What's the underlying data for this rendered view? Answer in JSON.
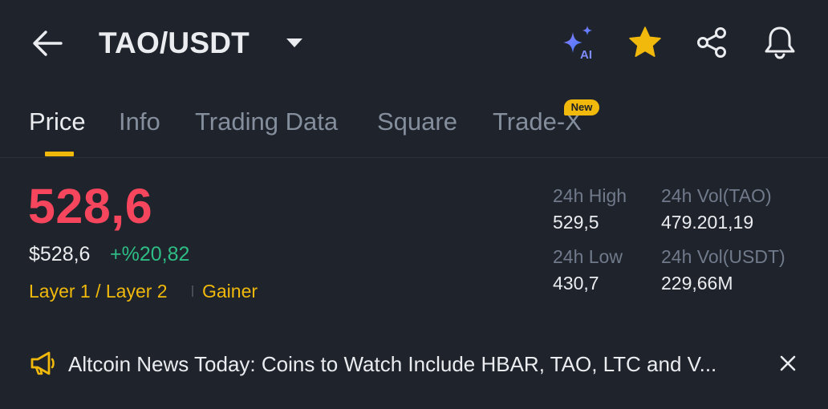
{
  "header": {
    "pair": "TAO/USDT",
    "icons": {
      "back": "back-arrow-icon",
      "dropdown": "caret-down-icon",
      "ai": "ai-sparkle-icon",
      "favorite": "star-icon",
      "share": "share-icon",
      "alerts": "bell-icon"
    },
    "ai_label": "AI",
    "favorite_color": "#f0b90b"
  },
  "tabs": [
    {
      "label": "Price",
      "active": true
    },
    {
      "label": "Info",
      "active": false
    },
    {
      "label": "Trading Data",
      "active": false
    },
    {
      "label": "Square",
      "active": false
    },
    {
      "label": "Trade-X",
      "active": false,
      "badge": "New"
    }
  ],
  "price": {
    "last": "528,6",
    "usd": "$528,6",
    "change": "+%20,82",
    "tags": [
      "Layer 1 / Layer 2",
      "Gainer"
    ]
  },
  "stats": {
    "high_label": "24h High",
    "high_value": "529,5",
    "low_label": "24h Low",
    "low_value": "430,7",
    "vol_base_label": "24h Vol(TAO)",
    "vol_base_value": "479.201,19",
    "vol_quote_label": "24h Vol(USDT)",
    "vol_quote_value": "229,66M"
  },
  "news": {
    "text": "Altcoin News Today: Coins to Watch Include HBAR, TAO, LTC and V...",
    "icon": "megaphone-icon",
    "close_icon": "close-icon"
  },
  "colors": {
    "background": "#1f232c",
    "accent": "#f0b90b",
    "down": "#f6465d",
    "up": "#2ebd85",
    "muted": "#848e9c"
  }
}
